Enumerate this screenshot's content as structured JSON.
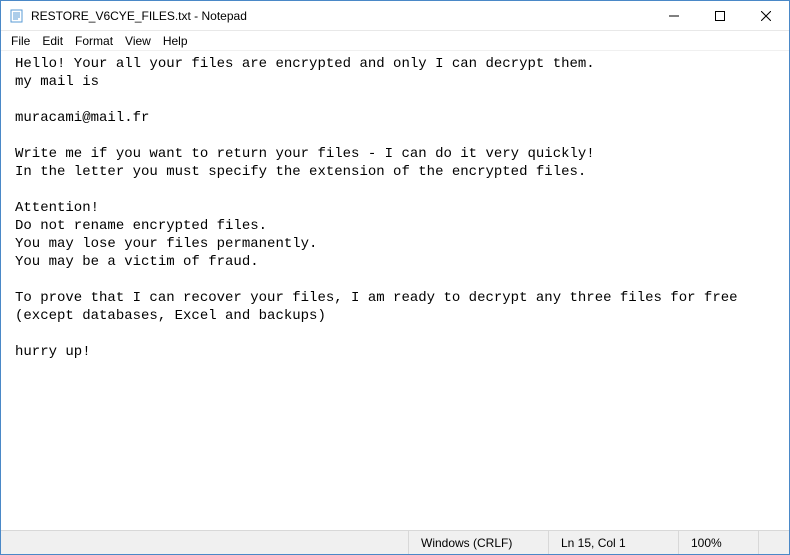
{
  "window": {
    "title": "RESTORE_V6CYE_FILES.txt - Notepad"
  },
  "menu": {
    "file": "File",
    "edit": "Edit",
    "format": "Format",
    "view": "View",
    "help": "Help"
  },
  "content": {
    "lines": [
      "Hello! Your all your files are encrypted and only I can decrypt them.",
      "my mail is",
      "",
      "muracami@mail.fr",
      "",
      "Write me if you want to return your files - I can do it very quickly!",
      "In the letter you must specify the extension of the encrypted files.",
      "",
      "Attention!",
      "Do not rename encrypted files.",
      "You may lose your files permanently.",
      "You may be a victim of fraud.",
      "",
      "To prove that I can recover your files, I am ready to decrypt any three files for free",
      "(except databases, Excel and backups)",
      "",
      "hurry up!"
    ]
  },
  "statusbar": {
    "encoding": "Windows (CRLF)",
    "position": "Ln 15, Col 1",
    "zoom": "100%"
  }
}
